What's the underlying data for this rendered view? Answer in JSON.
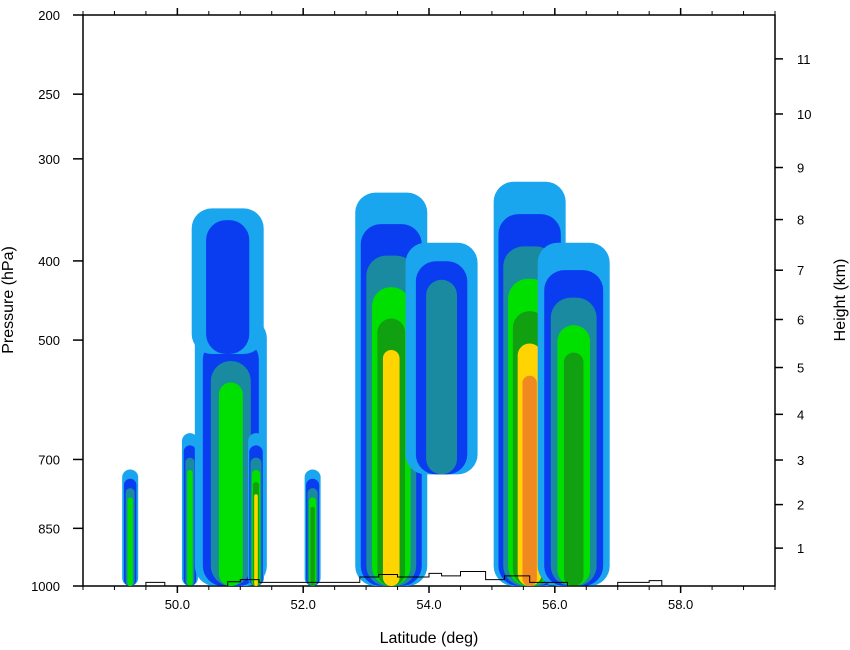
{
  "chart_data": {
    "type": "contour",
    "xlabel": "Latitude (deg)",
    "ylabel_left": "Pressure (hPa)",
    "ylabel_right": "Height (km)",
    "xlim": [
      48.5,
      59.5
    ],
    "ylim_pressure": [
      1000,
      200
    ],
    "x_ticks": [
      50.0,
      52.0,
      54.0,
      56.0,
      58.0
    ],
    "x_tick_labels": [
      "50.0",
      "52.0",
      "54.0",
      "56.0",
      "58.0"
    ],
    "pressure_ticks": [
      200,
      250,
      300,
      400,
      500,
      700,
      850,
      1000
    ],
    "pressure_tick_labels": [
      "200",
      "250",
      "300",
      "400",
      "500",
      "700",
      "850",
      "1000"
    ],
    "height_ticks": [
      1,
      2,
      3,
      4,
      5,
      6,
      7,
      8,
      9,
      10,
      11
    ],
    "height_tick_labels": [
      "1",
      "2",
      "3",
      "4",
      "5",
      "6",
      "7",
      "8",
      "9",
      "10",
      "11"
    ],
    "fill_levels_colors": [
      "#1aa6ef",
      "#0a3cf0",
      "#1a8aa0",
      "#00e000",
      "#10a010",
      "#ffd400",
      "#f08a20"
    ],
    "cells": [
      {
        "lat": 49.25,
        "p_top": 720,
        "p_bottom": 1000,
        "levels": 4
      },
      {
        "lat": 50.2,
        "p_top": 650,
        "p_bottom": 1000,
        "levels": 4
      },
      {
        "lat": 50.85,
        "p_top": 470,
        "p_bottom": 1000,
        "levels": 4
      },
      {
        "lat": 51.25,
        "p_top": 650,
        "p_bottom": 1000,
        "levels": 6
      },
      {
        "lat": 50.8,
        "p_top": 345,
        "p_bottom": 520,
        "levels": 2
      },
      {
        "lat": 52.15,
        "p_top": 720,
        "p_bottom": 1000,
        "levels": 5
      },
      {
        "lat": 53.4,
        "p_top": 330,
        "p_bottom": 1000,
        "levels": 6
      },
      {
        "lat": 54.2,
        "p_top": 380,
        "p_bottom": 730,
        "levels": 3
      },
      {
        "lat": 55.6,
        "p_top": 320,
        "p_bottom": 1000,
        "levels": 7
      },
      {
        "lat": 56.3,
        "p_top": 380,
        "p_bottom": 1000,
        "levels": 5
      }
    ]
  }
}
